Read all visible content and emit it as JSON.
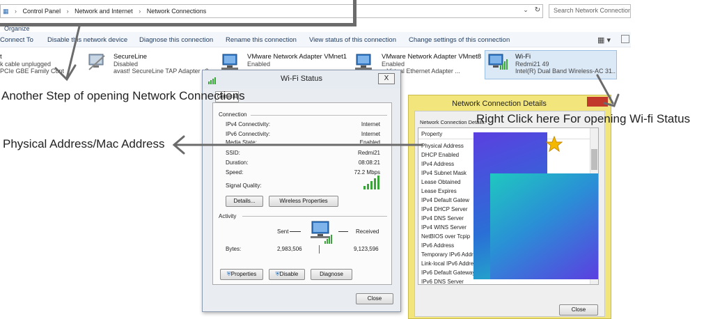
{
  "address_bar": {
    "crumbs": [
      "Control Panel",
      "Network and Internet",
      "Network Connections"
    ],
    "search_placeholder": "Search Network Connections"
  },
  "command_bar": {
    "items": [
      "Connect To",
      "Disable this network device",
      "Diagnose this connection",
      "Rename this connection",
      "View status of this connection",
      "Change settings of this connection"
    ],
    "organize_partial": "Organize"
  },
  "adapters": [
    {
      "name": "t",
      "status": "k cable unplugged",
      "device": "PCIe GBE Family Cont"
    },
    {
      "name": "SecureLine",
      "status": "Disabled",
      "device": "avast! SecureLine TAP Adapter v3"
    },
    {
      "name": "VMware Network Adapter VMnet1",
      "status": "Enabled",
      "device": ""
    },
    {
      "name": "VMware Network Adapter VMnet8",
      "status": "Enabled",
      "device": "e Virtual Ethernet Adapter ..."
    },
    {
      "name": "Wi-Fi",
      "status": "Redmi21  49",
      "device": "Intel(R) Dual Band Wireless-AC 31..."
    }
  ],
  "annotations": {
    "another_step": "Another Step of opening Network Connections",
    "physical_address": "Physical Address/Mac Address",
    "right_click": "Right Click here For opening Wi-fi Status"
  },
  "wifi_status": {
    "title": "Wi-Fi Status",
    "close_symbol": "X",
    "tab": "General",
    "connection_label": "Connection",
    "rows": [
      {
        "label": "IPv4 Connectivity:",
        "value": "Internet"
      },
      {
        "label": "IPv6 Connectivity:",
        "value": "Internet"
      },
      {
        "label": "Media State:",
        "value": "Enabled"
      },
      {
        "label": "SSID:",
        "value": "Redmi21"
      },
      {
        "label": "Duration:",
        "value": "08:08:21"
      },
      {
        "label": "Speed:",
        "value": "72.2 Mbps"
      }
    ],
    "signal_label": "Signal Quality:",
    "details_btn": "Details...",
    "wireless_btn": "Wireless Properties",
    "activity_label": "Activity",
    "sent_label": "Sent",
    "received_label": "Received",
    "bytes_label": "Bytes:",
    "bytes_sent": "2,983,506",
    "bytes_received": "9,123,596",
    "properties_btn": "Properties",
    "disable_btn": "Disable",
    "diagnose_btn": "Diagnose",
    "close_btn": "Close"
  },
  "details_window": {
    "title": "Network Connection Details",
    "section_label": "Network Connection Details:",
    "header": "Property",
    "properties": [
      "Physical Address",
      "DHCP Enabled",
      "IPv4 Address",
      "IPv4 Subnet Mask",
      "Lease Obtained",
      "Lease Expires",
      "IPv4 Default Gatew",
      "IPv4 DHCP Server",
      "IPv4 DNS Server",
      "IPv4 WINS Server",
      "NetBIOS over Tcpip",
      "IPv6 Address",
      "Temporary IPv6 Addr",
      "Link-local IPv6 Addre",
      "IPv6 Default Gateway",
      "IPv6 DNS Server"
    ],
    "close_btn": "Close"
  },
  "colors": {
    "arrow": "#6b6b6b",
    "signal": "#3aa63a",
    "details_frame": "#f2e57c",
    "star": "#f5b800"
  }
}
